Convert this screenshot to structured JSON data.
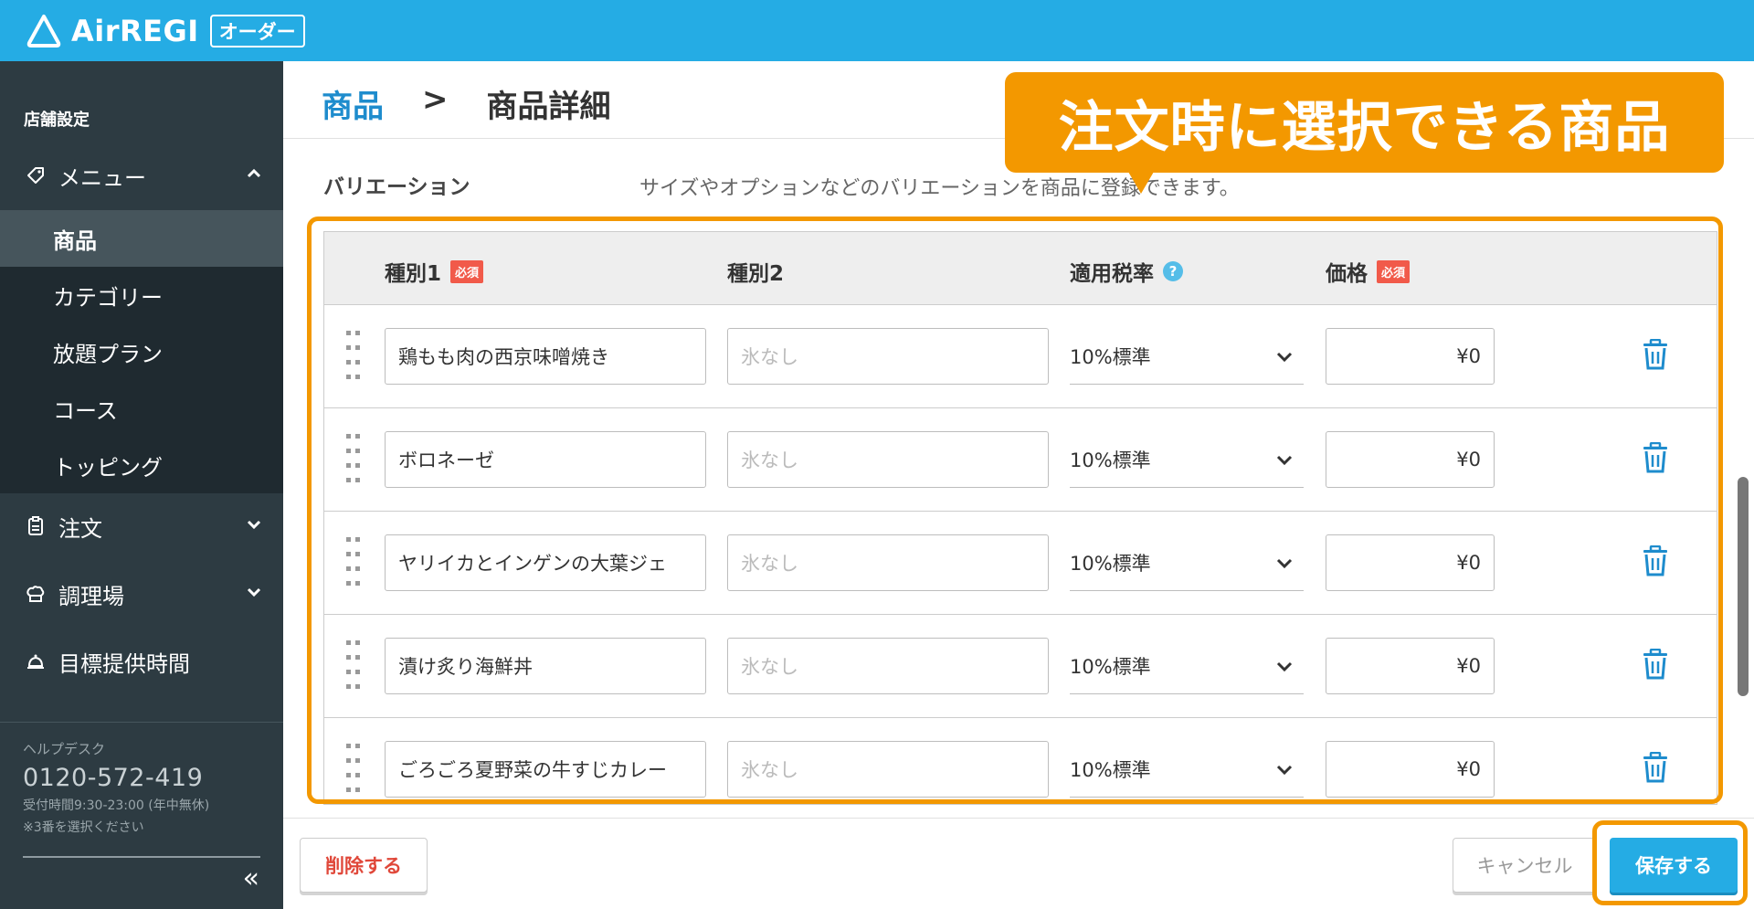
{
  "header": {
    "logo_text": "AirREGI",
    "logo_badge": "オーダー",
    "bg_color": "#25ace4"
  },
  "sidebar": {
    "section_title": "店舗設定",
    "menu_parent": {
      "label": "メニュー",
      "icon": "tag-icon",
      "expanded": true
    },
    "sub_items": [
      {
        "label": "商品",
        "active": true
      },
      {
        "label": "カテゴリー",
        "active": false
      },
      {
        "label": "放題プラン",
        "active": false
      },
      {
        "label": "コース",
        "active": false
      },
      {
        "label": "トッピング",
        "active": false
      }
    ],
    "items": [
      {
        "label": "注文",
        "icon": "clipboard-icon"
      },
      {
        "label": "調理場",
        "icon": "chef-hat-icon"
      },
      {
        "label": "目標提供時間",
        "icon": "bell-icon"
      }
    ],
    "help": {
      "title": "ヘルプデスク",
      "phone": "0120-572-419",
      "hours": "受付時間9:30-23:00 (年中無休)",
      "note": "※3番を選択ください"
    },
    "collapse_label": "«"
  },
  "breadcrumb": {
    "parent": "商品",
    "separator": ">",
    "current": "商品詳細"
  },
  "variation": {
    "label": "バリエーション",
    "description": "サイズやオプションなどのバリエーションを商品に登録できます。"
  },
  "table": {
    "headers": {
      "type1": "種別1",
      "type2": "種別2",
      "tax": "適用税率",
      "price": "価格",
      "required_badge": "必須",
      "help_icon": "?"
    },
    "rows": [
      {
        "name": "鶏もも肉の西京味噌焼き",
        "type2_placeholder": "氷なし",
        "tax": "10%標準",
        "price": "¥0"
      },
      {
        "name": "ボロネーゼ",
        "type2_placeholder": "氷なし",
        "tax": "10%標準",
        "price": "¥0"
      },
      {
        "name": "ヤリイカとインゲンの大葉ジェ",
        "type2_placeholder": "氷なし",
        "tax": "10%標準",
        "price": "¥0"
      },
      {
        "name": "漬け炙り海鮮丼",
        "type2_placeholder": "氷なし",
        "tax": "10%標準",
        "price": "¥0"
      },
      {
        "name": "ごろごろ夏野菜の牛すじカレー",
        "type2_placeholder": "氷なし",
        "tax": "10%標準",
        "price": "¥0"
      }
    ]
  },
  "footer": {
    "delete_label": "削除する",
    "cancel_label": "キャンセル",
    "save_label": "保存する"
  },
  "annotation": {
    "callout_text": "注文時に選択できる商品",
    "color": "#f39800"
  }
}
